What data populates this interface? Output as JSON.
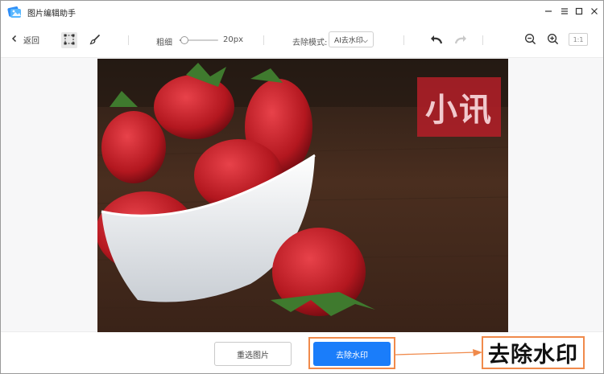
{
  "app": {
    "title": "图片编辑助手",
    "icon": "picture-editor-app-icon"
  },
  "window_controls": {
    "minimize": "minimize-icon",
    "menu": "menu-icon",
    "maximize": "maximize-icon",
    "close": "close-icon"
  },
  "toolbar": {
    "back_label": "返回",
    "thickness_label": "粗细",
    "thickness_value": "20px",
    "thickness_fraction": 0.12,
    "mode_label": "去除模式:",
    "mode_selected": "AI去水印",
    "ratio_label": "1:1"
  },
  "canvas": {
    "watermark_text": "小讯"
  },
  "actions": {
    "reselect_label": "重选图片",
    "remove_label": "去除水印"
  },
  "annotation": {
    "callout_text": "去除水印"
  },
  "colors": {
    "accent": "#1a7dfa",
    "highlight": "#f08a4b",
    "watermark_bg": "#b41e28"
  }
}
